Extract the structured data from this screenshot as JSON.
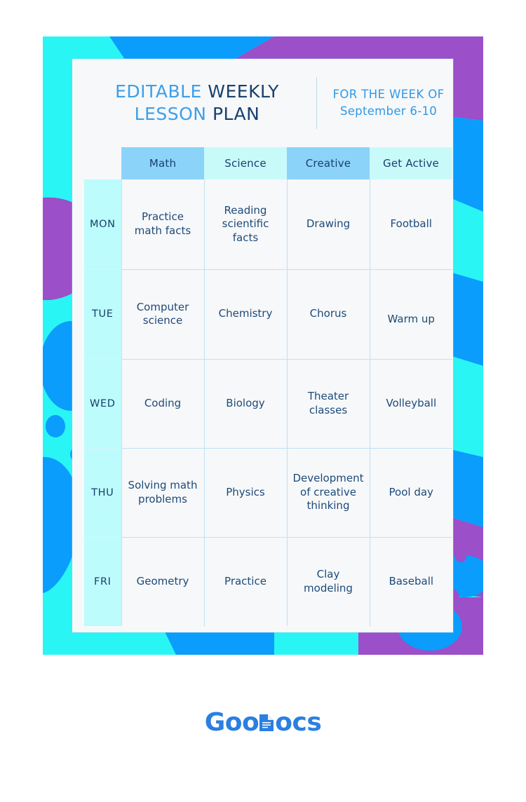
{
  "poster": {
    "colors": {
      "cyan": "#2af5f5",
      "blue": "#0a9dfc",
      "purple": "#9b4fc8",
      "card_bg": "#f7f8fa"
    }
  },
  "header": {
    "title_line1_light": "EDITABLE",
    "title_line1_dark": "WEEKLY",
    "title_line2_light": "LESSON",
    "title_line2_dark": "PLAN",
    "week_label": "FOR THE WEEK OF",
    "week_value": "September 6-10"
  },
  "table": {
    "corner_header": "",
    "columns": [
      {
        "label": "Math",
        "style": "hdr-a"
      },
      {
        "label": "Science",
        "style": "hdr-b"
      },
      {
        "label": "Creative",
        "style": "hdr-a"
      },
      {
        "label": "Get Active",
        "style": "hdr-b"
      }
    ],
    "rows": [
      {
        "day": "MON",
        "cells": [
          "Practice math facts",
          "Reading scientific facts",
          "Drawing",
          "Football"
        ]
      },
      {
        "day": "TUE",
        "cells": [
          "Computer science",
          "Chemistry",
          "Chorus",
          "Warm up"
        ]
      },
      {
        "day": "WED",
        "cells": [
          "Coding",
          "Biology",
          "Theater classes",
          "Volleyball"
        ]
      },
      {
        "day": "THU",
        "cells": [
          "Solving math problems",
          "Physics",
          "Development of creative thinking",
          "Pool day"
        ]
      },
      {
        "day": "FRI",
        "cells": [
          "Geometry",
          "Practice",
          "Clay modeling",
          "Baseball"
        ]
      }
    ]
  },
  "footer": {
    "logo_part1": "Goo",
    "logo_part2": "ocs",
    "logo_color": "#2b7fe0"
  }
}
